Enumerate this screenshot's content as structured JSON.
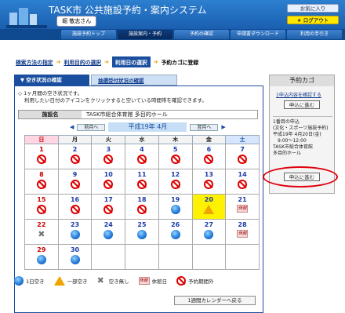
{
  "header": {
    "title": "TASK市 公共施設予約・案内システム",
    "user": "堀 敬志さん",
    "help_button": "お気に入り",
    "logout_button": "ログアウト"
  },
  "nav": {
    "items": [
      "施設予約トップ",
      "施設案内・予約",
      "予約の確認",
      "申請書ダウンロード",
      "利用の手引き"
    ],
    "active_index": 1
  },
  "breadcrumb": {
    "step1": "検索方法の指定",
    "step2": "利用目的の選択",
    "step3": "利用日の選択",
    "step4": "予約カゴに登録"
  },
  "tabs": {
    "tab1": "空き状況の確認",
    "tab2": "抽選受付状況の確認"
  },
  "info": {
    "line1": "1ヶ月間の空き状況です。",
    "line2": "利用したい日付のアイコンをクリックすると空いている時間帯を確認できます。"
  },
  "facility": {
    "label": "施設名",
    "value": "TASK市総合体育館 多目的ホール"
  },
  "month_nav": {
    "prev": "前月へ",
    "title": "平成19年 4月",
    "next": "翌月へ"
  },
  "calendar": {
    "weekdays": [
      "日",
      "月",
      "火",
      "水",
      "木",
      "金",
      "土"
    ],
    "weeks": [
      [
        {
          "d": "1",
          "s": "no"
        },
        {
          "d": "2",
          "s": "no"
        },
        {
          "d": "3",
          "s": "no"
        },
        {
          "d": "4",
          "s": "no"
        },
        {
          "d": "5",
          "s": "no"
        },
        {
          "d": "6",
          "s": "no"
        },
        {
          "d": "7",
          "s": "no"
        }
      ],
      [
        {
          "d": "8",
          "s": "no"
        },
        {
          "d": "9",
          "s": "no"
        },
        {
          "d": "10",
          "s": "no"
        },
        {
          "d": "11",
          "s": "no"
        },
        {
          "d": "12",
          "s": "no"
        },
        {
          "d": "13",
          "s": "no"
        },
        {
          "d": "14",
          "s": "no"
        }
      ],
      [
        {
          "d": "15",
          "s": "no"
        },
        {
          "d": "16",
          "s": "no"
        },
        {
          "d": "17",
          "s": "no"
        },
        {
          "d": "18",
          "s": "no"
        },
        {
          "d": "19",
          "s": "ok"
        },
        {
          "d": "20",
          "s": "part",
          "hl": true
        },
        {
          "d": "21",
          "s": "hol"
        }
      ],
      [
        {
          "d": "22",
          "s": "x"
        },
        {
          "d": "23",
          "s": "ok"
        },
        {
          "d": "24",
          "s": "ok"
        },
        {
          "d": "25",
          "s": "ok"
        },
        {
          "d": "26",
          "s": "ok"
        },
        {
          "d": "27",
          "s": "ok"
        },
        {
          "d": "28",
          "s": "hol"
        }
      ],
      [
        {
          "d": "29",
          "s": "ok"
        },
        {
          "d": "30",
          "s": "ok"
        },
        {
          "d": "",
          "s": ""
        },
        {
          "d": "",
          "s": ""
        },
        {
          "d": "",
          "s": ""
        },
        {
          "d": "",
          "s": ""
        },
        {
          "d": "",
          "s": ""
        }
      ]
    ]
  },
  "holiday_icon_text": "休館",
  "legend": {
    "ok": "1日空き",
    "part": "一部空き",
    "x": "空き無し",
    "hol": "休館日",
    "no": "予約期間外",
    "hol_icon": "休館"
  },
  "back_button": "1週間カレンダーへ戻る",
  "cart": {
    "title": "予約カゴ",
    "check_link": "1申込内容を確認する",
    "apply_button": "申込に進む",
    "item_title": "1番目の申込",
    "item_type": "(文化・スポーツ施設予約)",
    "item_date": "平成19年 4月20日(金)",
    "item_time": "9:00～12:00",
    "item_fac1": "TASK市総合体育館",
    "item_fac2": "多目的ホール",
    "apply_button2": "申込に進む"
  }
}
